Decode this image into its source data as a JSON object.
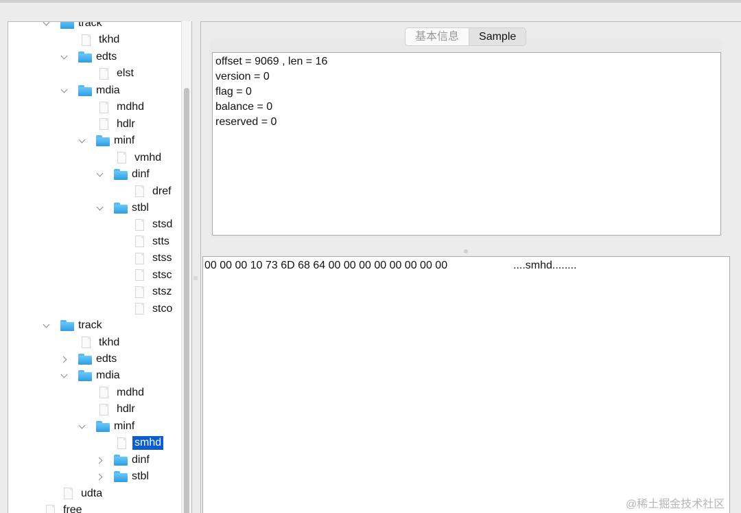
{
  "tree": {
    "nodes": [
      {
        "label": "track",
        "depth": 1,
        "kind": "folder",
        "arrow": "down"
      },
      {
        "label": "tkhd",
        "depth": 2,
        "kind": "file"
      },
      {
        "label": "edts",
        "depth": 2,
        "kind": "folder",
        "arrow": "down"
      },
      {
        "label": "elst",
        "depth": 3,
        "kind": "file"
      },
      {
        "label": "mdia",
        "depth": 2,
        "kind": "folder",
        "arrow": "down"
      },
      {
        "label": "mdhd",
        "depth": 3,
        "kind": "file"
      },
      {
        "label": "hdlr",
        "depth": 3,
        "kind": "file"
      },
      {
        "label": "minf",
        "depth": 3,
        "kind": "folder",
        "arrow": "down"
      },
      {
        "label": "vmhd",
        "depth": 4,
        "kind": "file"
      },
      {
        "label": "dinf",
        "depth": 4,
        "kind": "folder",
        "arrow": "down"
      },
      {
        "label": "dref",
        "depth": 5,
        "kind": "file"
      },
      {
        "label": "stbl",
        "depth": 4,
        "kind": "folder",
        "arrow": "down"
      },
      {
        "label": "stsd",
        "depth": 5,
        "kind": "file"
      },
      {
        "label": "stts",
        "depth": 5,
        "kind": "file"
      },
      {
        "label": "stss",
        "depth": 5,
        "kind": "file"
      },
      {
        "label": "stsc",
        "depth": 5,
        "kind": "file"
      },
      {
        "label": "stsz",
        "depth": 5,
        "kind": "file"
      },
      {
        "label": "stco",
        "depth": 5,
        "kind": "file"
      },
      {
        "label": "track",
        "depth": 1,
        "kind": "folder",
        "arrow": "down"
      },
      {
        "label": "tkhd",
        "depth": 2,
        "kind": "file"
      },
      {
        "label": "edts",
        "depth": 2,
        "kind": "folder",
        "arrow": "right"
      },
      {
        "label": "mdia",
        "depth": 2,
        "kind": "folder",
        "arrow": "down"
      },
      {
        "label": "mdhd",
        "depth": 3,
        "kind": "file"
      },
      {
        "label": "hdlr",
        "depth": 3,
        "kind": "file"
      },
      {
        "label": "minf",
        "depth": 3,
        "kind": "folder",
        "arrow": "down"
      },
      {
        "label": "smhd",
        "depth": 4,
        "kind": "file",
        "selected": true
      },
      {
        "label": "dinf",
        "depth": 4,
        "kind": "folder",
        "arrow": "right"
      },
      {
        "label": "stbl",
        "depth": 4,
        "kind": "folder",
        "arrow": "right"
      },
      {
        "label": "udta",
        "depth": 1,
        "kind": "file"
      },
      {
        "label": "free",
        "depth": 0,
        "kind": "file"
      }
    ]
  },
  "tabs": [
    {
      "label": "基本信息",
      "active": false
    },
    {
      "label": "Sample",
      "active": true
    }
  ],
  "info": {
    "lines": [
      "offset = 9069 , len = 16",
      "version = 0",
      "flag = 0",
      "balance = 0",
      "reserved = 0"
    ]
  },
  "hex": {
    "bytes": "00 00 00 10 73 6D 68 64 00 00 00 00 00 00 00 00",
    "ascii": "....smhd........"
  },
  "watermark": "@稀土掘金技术社区"
}
